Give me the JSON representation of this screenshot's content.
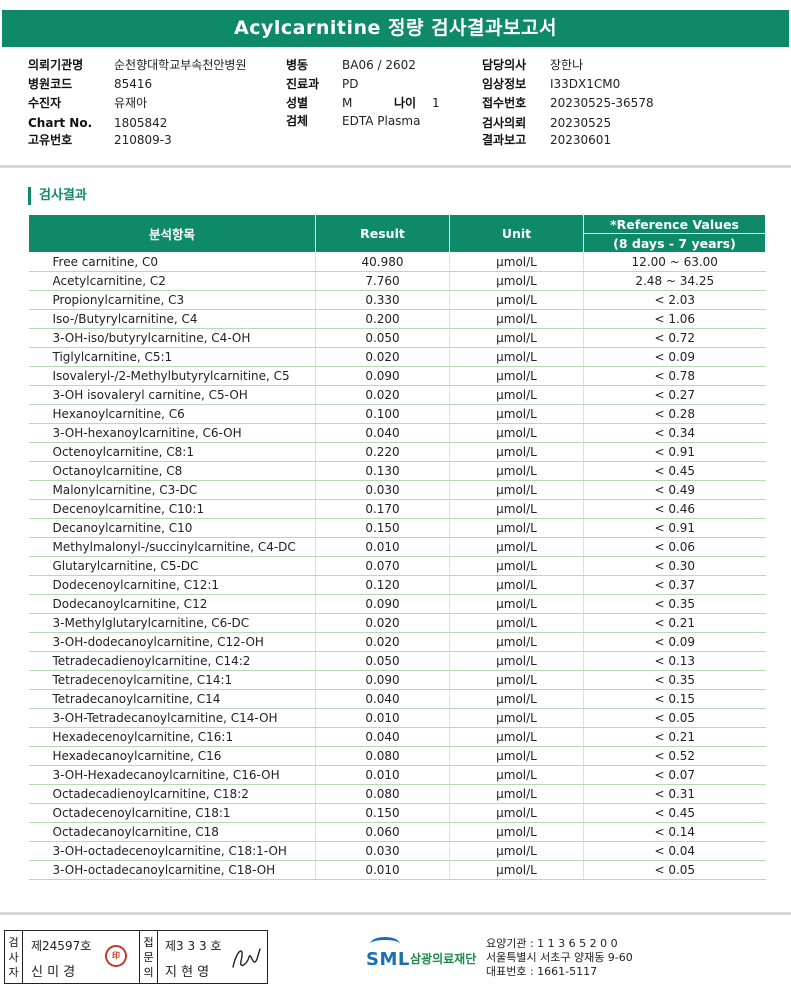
{
  "title": "Acylcarnitine 정량 검사결과보고서",
  "patient_info": {
    "col1": [
      {
        "label": "의뢰기관명",
        "value": "순천향대학교부속천안병원"
      },
      {
        "label": "병원코드",
        "value": "85416"
      },
      {
        "label": "수진자",
        "value": "유재아"
      },
      {
        "label": "Chart No.",
        "value": "1805842"
      },
      {
        "label": "고유번호",
        "value": "210809-3"
      }
    ],
    "col2": [
      {
        "label": "병동",
        "value": "BA06 / 2602"
      },
      {
        "label": "진료과",
        "value": "PD"
      },
      {
        "label": "성별",
        "value": "M"
      },
      {
        "label": "검체",
        "value": "EDTA Plasma"
      }
    ],
    "age": {
      "label": "나이",
      "value": "1"
    },
    "col3": [
      {
        "label": "담당의사",
        "value": "장한나"
      },
      {
        "label": "임상정보",
        "value": "I33DX1CM0"
      },
      {
        "label": "접수번호",
        "value": "20230525-36578"
      },
      {
        "label": "검사의뢰",
        "value": "20230525"
      },
      {
        "label": "결과보고",
        "value": "20230601"
      }
    ]
  },
  "section_title": "검사결과",
  "table": {
    "headers": {
      "item": "분석항목",
      "result": "Result",
      "unit": "Unit",
      "reference": "*Reference Values",
      "reference_range": "(8 days - 7 years)"
    },
    "rows": [
      {
        "name": "Free carnitine, C0",
        "result": "40.980",
        "unit": "µmol/L",
        "ref": "12.00 ~ 63.00"
      },
      {
        "name": "Acetylcarnitine, C2",
        "result": "7.760",
        "unit": "µmol/L",
        "ref": "2.48 ~ 34.25"
      },
      {
        "name": "Propionylcarnitine, C3",
        "result": "0.330",
        "unit": "µmol/L",
        "ref": "< 2.03"
      },
      {
        "name": "Iso-/Butyrylcarnitine, C4",
        "result": "0.200",
        "unit": "µmol/L",
        "ref": "< 1.06"
      },
      {
        "name": "3-OH-iso/butyrylcarnitine, C4-OH",
        "result": "0.050",
        "unit": "µmol/L",
        "ref": "< 0.72"
      },
      {
        "name": "Tiglylcarnitine, C5:1",
        "result": "0.020",
        "unit": "µmol/L",
        "ref": "< 0.09"
      },
      {
        "name": "Isovaleryl-/2-Methylbutyrylcarnitine, C5",
        "result": "0.090",
        "unit": "µmol/L",
        "ref": "< 0.78"
      },
      {
        "name": "3-OH isovaleryl carnitine, C5-OH",
        "result": "0.020",
        "unit": "µmol/L",
        "ref": "< 0.27"
      },
      {
        "name": "Hexanoylcarnitine, C6",
        "result": "0.100",
        "unit": "µmol/L",
        "ref": "< 0.28"
      },
      {
        "name": "3-OH-hexanoylcarnitine, C6-OH",
        "result": "0.040",
        "unit": "µmol/L",
        "ref": "< 0.34"
      },
      {
        "name": "Octenoylcarnitine, C8:1",
        "result": "0.220",
        "unit": "µmol/L",
        "ref": "< 0.91"
      },
      {
        "name": "Octanoylcarnitine, C8",
        "result": "0.130",
        "unit": "µmol/L",
        "ref": "< 0.45"
      },
      {
        "name": "Malonylcarnitine, C3-DC",
        "result": "0.030",
        "unit": "µmol/L",
        "ref": "< 0.49"
      },
      {
        "name": "Decenoylcarnitine, C10:1",
        "result": "0.170",
        "unit": "µmol/L",
        "ref": "< 0.46"
      },
      {
        "name": "Decanoylcarnitine, C10",
        "result": "0.150",
        "unit": "µmol/L",
        "ref": "< 0.91"
      },
      {
        "name": "Methylmalonyl-/succinylcarnitine, C4-DC",
        "result": "0.010",
        "unit": "µmol/L",
        "ref": "< 0.06"
      },
      {
        "name": "Glutarylcarnitine, C5-DC",
        "result": "0.070",
        "unit": "µmol/L",
        "ref": "< 0.30"
      },
      {
        "name": "Dodecenoylcarnitine, C12:1",
        "result": "0.120",
        "unit": "µmol/L",
        "ref": "< 0.37"
      },
      {
        "name": "Dodecanoylcarnitine, C12",
        "result": "0.090",
        "unit": "µmol/L",
        "ref": "< 0.35"
      },
      {
        "name": "3-Methylglutarylcarnitine, C6-DC",
        "result": "0.020",
        "unit": "µmol/L",
        "ref": "< 0.21"
      },
      {
        "name": "3-OH-dodecanoylcarnitine, C12-OH",
        "result": "0.020",
        "unit": "µmol/L",
        "ref": "< 0.09"
      },
      {
        "name": "Tetradecadienoylcarnitine, C14:2",
        "result": "0.050",
        "unit": "µmol/L",
        "ref": "< 0.13"
      },
      {
        "name": "Tetradecenoylcarnitine, C14:1",
        "result": "0.090",
        "unit": "µmol/L",
        "ref": "< 0.35"
      },
      {
        "name": "Tetradecanoylcarnitine, C14",
        "result": "0.040",
        "unit": "µmol/L",
        "ref": "< 0.15"
      },
      {
        "name": "3-OH-Tetradecanoylcarnitine, C14-OH",
        "result": "0.010",
        "unit": "µmol/L",
        "ref": "< 0.05"
      },
      {
        "name": "Hexadecenoylcarnitine, C16:1",
        "result": "0.040",
        "unit": "µmol/L",
        "ref": "< 0.21"
      },
      {
        "name": "Hexadecanoylcarnitine, C16",
        "result": "0.080",
        "unit": "µmol/L",
        "ref": "< 0.52"
      },
      {
        "name": "3-OH-Hexadecanoylcarnitine, C16-OH",
        "result": "0.010",
        "unit": "µmol/L",
        "ref": "< 0.07"
      },
      {
        "name": "Octadecadienoylcarnitine, C18:2",
        "result": "0.080",
        "unit": "µmol/L",
        "ref": "< 0.31"
      },
      {
        "name": "Octadecenoylcarnitine, C18:1",
        "result": "0.150",
        "unit": "µmol/L",
        "ref": "< 0.45"
      },
      {
        "name": "Octadecanoylcarnitine, C18",
        "result": "0.060",
        "unit": "µmol/L",
        "ref": "< 0.14"
      },
      {
        "name": "3-OH-octadecenoylcarnitine, C18:1-OH",
        "result": "0.030",
        "unit": "µmol/L",
        "ref": "< 0.04"
      },
      {
        "name": "3-OH-octadecanoylcarnitine, C18-OH",
        "result": "0.010",
        "unit": "µmol/L",
        "ref": "< 0.05"
      }
    ]
  },
  "footer": {
    "tester_label": "검사자",
    "tester_no": "제24597호",
    "tester_name": "신 미 경",
    "confirmer_label": "접문의",
    "confirmer_no": "제3 3 3 호",
    "confirmer_name": "지 현 영",
    "logo_text": "SML",
    "org_name": "삼광의료재단",
    "address_lines": [
      "요양기관 : 1 1 3 6 5 2 0 0",
      "서울특별시 서초구 양재동 9-60",
      "대표번호 : 1661-5117"
    ]
  },
  "colors": {
    "header_green": "#0f8a68",
    "row_border": "#b8d9b8",
    "logo_blue": "#1b6fb0",
    "seal_red": "#c0392b"
  }
}
